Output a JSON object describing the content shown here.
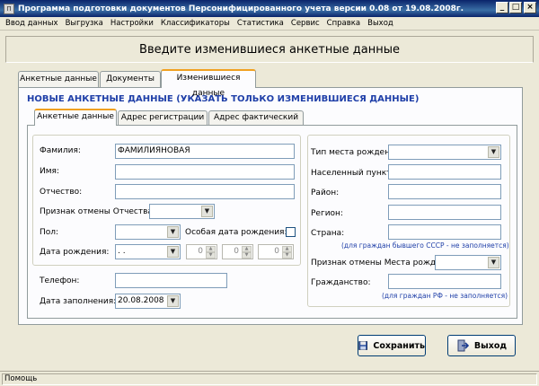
{
  "window": {
    "title": "Программа подготовки документов Персонифицированного учета версии 0.08 от 19.08.2008г.",
    "icon_label": "П",
    "min_icon": "minimize-icon",
    "max_icon": "maximize-icon",
    "close_icon": "close-icon"
  },
  "menu": [
    "Ввод данных",
    "Выгрузка",
    "Настройки",
    "Классификаторы",
    "Статистика",
    "Сервис",
    "Справка",
    "Выход"
  ],
  "header": {
    "title": "Введите изменившиеся анкетные данные"
  },
  "outer_tabs": [
    {
      "label": "Анкетные данные",
      "active": false
    },
    {
      "label": "Документы",
      "active": false
    },
    {
      "label": "Изменившиеся данные",
      "active": true
    }
  ],
  "section_title": "НОВЫЕ АНКЕТНЫЕ ДАННЫЕ (УКАЗАТЬ ТОЛЬКО ИЗМЕНИВШИЕСЯ ДАННЫЕ)",
  "inner_tabs": [
    {
      "label": "Анкетные данные",
      "active": true
    },
    {
      "label": "Адрес регистрации",
      "active": false
    },
    {
      "label": "Адрес фактический",
      "active": false
    }
  ],
  "left_form": {
    "surname_label": "Фамилия:",
    "surname_value": "ФАМИЛИЯНОВАЯ",
    "name_label": "Имя:",
    "name_value": "",
    "patronymic_label": "Отчество:",
    "patronymic_value": "",
    "cancel_patronymic_label": "Признак отмены Отчества:",
    "cancel_patronymic_value": "",
    "sex_label": "Пол:",
    "sex_value": "",
    "special_birthdate_label": "Особая дата рождения:",
    "special_birthdate_checked": false,
    "birthdate_label": "Дата рождения:",
    "birthdate_value": " .  .",
    "spin1": "0",
    "spin2": "0",
    "spin3": "0"
  },
  "bottom_form": {
    "phone_label": "Телефон:",
    "phone_value": "",
    "fill_date_label": "Дата заполнения:",
    "fill_date_value": "20.08.2008"
  },
  "right_form": {
    "birthplace_type_label": "Тип места рожден:",
    "birthplace_type_value": "",
    "settlement_label": "Населенный пункт:",
    "settlement_value": "",
    "district_label": "Район:",
    "district_value": "",
    "region_label": "Регион:",
    "region_value": "",
    "country_label": "Страна:",
    "country_value": "",
    "country_note": "(для граждан бывшего СССР - не заполняется)",
    "cancel_birthplace_label": "Признак отмены Места рожд.:",
    "cancel_birthplace_value": "",
    "citizenship_label": "Гражданство:",
    "citizenship_value": "",
    "citizenship_note": "(для граждан РФ - не заполняется)"
  },
  "buttons": {
    "save_label": "Сохранить",
    "exit_label": "Выход"
  },
  "status": {
    "text": "Помощь"
  }
}
